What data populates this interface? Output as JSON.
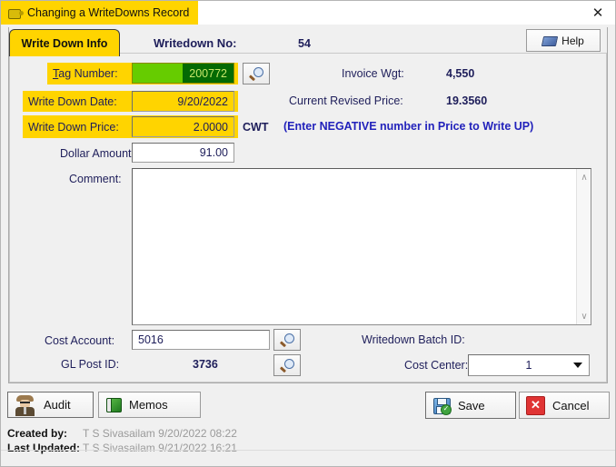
{
  "window": {
    "title": "Changing a WriteDowns Record",
    "title_icon": "barrel-icon",
    "close_icon": "close-icon",
    "accent_yellow": "#FFD400",
    "accent_green": "#66CC00",
    "selection_green": "#046A04",
    "label_color": "#1e1e5a",
    "note_color": "#2222BB"
  },
  "tab": {
    "label": "Write Down Info"
  },
  "header": {
    "writedown_no_label": "Writedown No:",
    "writedown_no_value": "54",
    "help_label": "Help",
    "help_icon": "book-icon"
  },
  "form": {
    "tag_number": {
      "label": "Tag Number:",
      "accelerator": "T",
      "label_rest": "ag Number:",
      "value": "200772",
      "lookup_icon": "magnifier-icon"
    },
    "write_down_date": {
      "label": "Write Down Date:",
      "value": "9/20/2022"
    },
    "write_down_price": {
      "label": "Write Down Price:",
      "value": "2.0000",
      "unit": "CWT"
    },
    "dollar_amount": {
      "label": "Dollar Amount:",
      "value": "91.00"
    },
    "comment": {
      "label": "Comment:",
      "value": ""
    },
    "cost_account": {
      "label": "Cost Account:",
      "value": "5016",
      "lookup_icon": "magnifier-icon"
    },
    "gl_post_id": {
      "label": "GL Post ID:",
      "value": "3736",
      "lookup_icon": "magnifier-icon"
    },
    "writedown_batch_id": {
      "label": "Writedown Batch ID:",
      "value": ""
    },
    "cost_center": {
      "label": "Cost Center:",
      "value": "1",
      "options": [
        "1"
      ],
      "arrow_icon": "chevron-down-icon"
    }
  },
  "info": {
    "invoice_wgt_label": "Invoice Wgt:",
    "invoice_wgt_value": "4,550",
    "current_revised_price_label": "Current Revised Price:",
    "current_revised_price_value": "19.3560",
    "note": "(Enter NEGATIVE number in Price to Write UP)"
  },
  "footer": {
    "audit_label": "Audit",
    "audit_icon": "detective-icon",
    "memos_label": "Memos",
    "memos_icon": "green-book-icon",
    "save_label": "Save",
    "save_icon": "floppy-disk-icon",
    "cancel_label": "Cancel",
    "cancel_icon": "red-x-icon",
    "created_by_label": "Created by:",
    "created_by_value": "T S Sivasailam 9/20/2022 08:22",
    "last_updated_label": "Last Updated:",
    "last_updated_value": "T S Sivasailam 9/21/2022 16:21"
  }
}
